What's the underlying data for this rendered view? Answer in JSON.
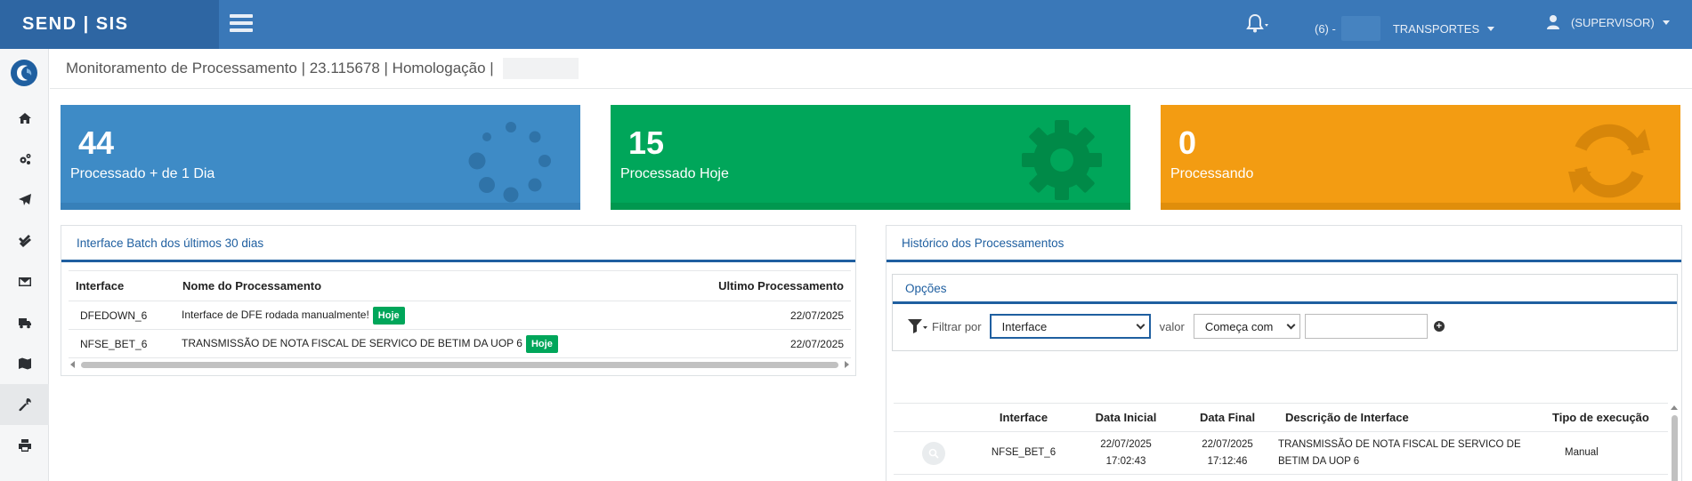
{
  "app": {
    "brand": "SEND | SIS",
    "tenant_prefix": "(6) -",
    "company": "TRANSPORTES",
    "user": "(SUPERVISOR)"
  },
  "sidebar": {
    "items": [
      "home-icon",
      "cogs-icon",
      "paper-plane-icon",
      "check-double-icon",
      "envelope-icon",
      "truck-icon",
      "map-icon",
      "wrench-icon",
      "print-icon"
    ],
    "active": "wrench-icon"
  },
  "page": {
    "title": "Monitoramento de Processamento | 23.115678 | Homologação |"
  },
  "cards": [
    {
      "value": "44",
      "label": "Processado + de 1 Dia",
      "color": "#3e8bc6",
      "icon": "spinner-icon"
    },
    {
      "value": "15",
      "label": "Processado Hoje",
      "color": "#00a65a",
      "icon": "gear-icon"
    },
    {
      "value": "0",
      "label": "Processando",
      "color": "#f39c12",
      "icon": "refresh-icon"
    }
  ],
  "batch": {
    "title": "Interface Batch dos últimos 30 dias",
    "columns": [
      "Interface",
      "Nome do Processamento",
      "Ultimo Processamento"
    ],
    "rows": [
      {
        "interface": "DFEDOWN_6",
        "name": "Interface de DFE rodada manualmente!",
        "badge": "Hoje",
        "last": "22/07/2025"
      },
      {
        "interface": "NFSE_BET_6",
        "name": "TRANSMISSÃO DE NOTA FISCAL DE SERVICO DE BETIM DA UOP 6",
        "badge": "Hoje",
        "last": "22/07/2025"
      }
    ]
  },
  "history": {
    "title": "Histórico dos Processamentos",
    "options_title": "Opções",
    "filter_label": "Filtrar por",
    "filter_field": "Interface",
    "value_label": "valor",
    "condition": "Começa com",
    "columns": [
      "Interface",
      "Data Inicial",
      "Data Final",
      "Descrição de Interface",
      "Tipo de execução"
    ],
    "rows": [
      {
        "interface": "NFSE_BET_6",
        "start_date": "22/07/2025",
        "start_time": "17:02:43",
        "end_date": "22/07/2025",
        "end_time": "17:12:46",
        "description": "TRANSMISSÃO DE NOTA FISCAL DE SERVICO DE BETIM DA UOP 6",
        "type": "Manual"
      }
    ]
  }
}
